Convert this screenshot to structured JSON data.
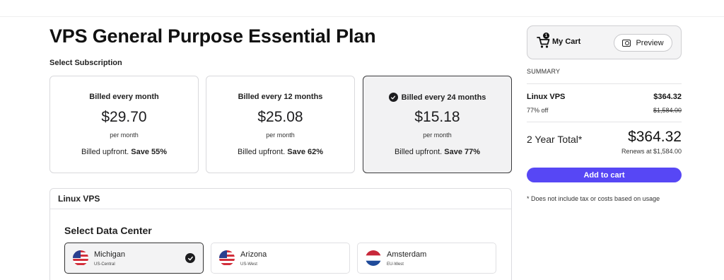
{
  "page_title": "VPS General Purpose Essential Plan",
  "subscription_label": "Select Subscription",
  "plans": [
    {
      "period": "Billed every month",
      "price": "$29.70",
      "per": "per month",
      "billed_prefix": "Billed upfront.",
      "save": "Save 55%",
      "selected": false
    },
    {
      "period": "Billed every 12 months",
      "price": "$25.08",
      "per": "per month",
      "billed_prefix": "Billed upfront.",
      "save": "Save 62%",
      "selected": false
    },
    {
      "period": "Billed every 24 months",
      "price": "$15.18",
      "per": "per month",
      "billed_prefix": "Billed upfront.",
      "save": "Save 77%",
      "selected": true
    }
  ],
  "linux_section": {
    "title": "Linux VPS",
    "data_center_title": "Select Data Center",
    "data_centers": [
      {
        "name": "Michigan",
        "region": "US-Central",
        "flag": "us-flag-icon",
        "selected": true
      },
      {
        "name": "Arizona",
        "region": "US-West",
        "flag": "us-flag-icon",
        "selected": false
      },
      {
        "name": "Amsterdam",
        "region": "EU-West",
        "flag": "nl-flag-icon",
        "selected": false
      }
    ]
  },
  "cart": {
    "badge_count": "1",
    "title": "My Cart",
    "preview_label": "Preview",
    "summary_label": "SUMMARY",
    "item_name": "Linux VPS",
    "item_price": "$364.32",
    "discount_label": "77% off",
    "original_price": "$1,584.00",
    "total_label": "2 Year Total*",
    "total_price": "$364.32",
    "renews": "Renews at $1,584.00",
    "add_to_cart_label": "Add to cart",
    "disclaimer": "* Does not include tax or costs based on usage"
  },
  "colors": {
    "accent": "#5747f5",
    "selected_bg": "#f2f2f3",
    "text": "#1d1d1f"
  }
}
